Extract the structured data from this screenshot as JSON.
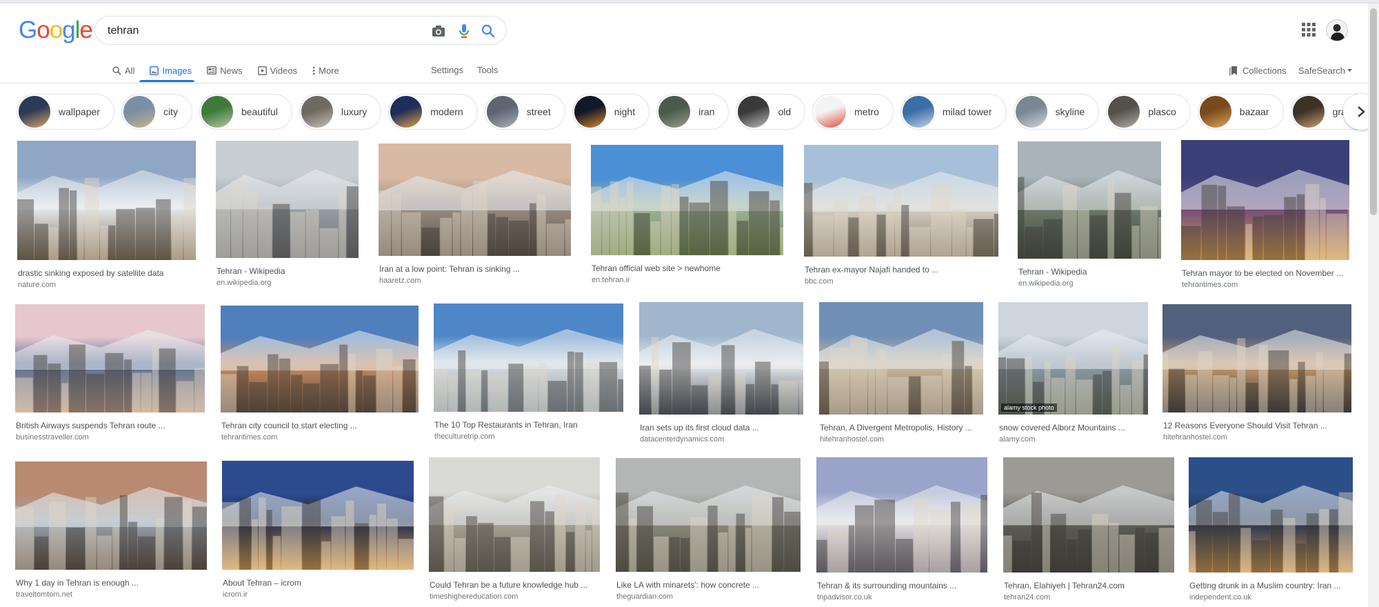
{
  "logo": {
    "text": "Google",
    "letters": [
      "G",
      "o",
      "o",
      "g",
      "l",
      "e"
    ],
    "colors": [
      "#4285f4",
      "#ea4335",
      "#fbbc05",
      "#4285f4",
      "#34a853",
      "#ea4335"
    ]
  },
  "search": {
    "query": "tehran",
    "camera_icon": "camera-icon",
    "mic_icon": "microphone-icon",
    "search_icon": "search-icon"
  },
  "header": {
    "apps_icon": "apps-grid-icon",
    "avatar_icon": "account-avatar"
  },
  "tabs": [
    {
      "label": "All",
      "icon": "search-icon"
    },
    {
      "label": "Images",
      "icon": "image-icon"
    },
    {
      "label": "News",
      "icon": "news-icon"
    },
    {
      "label": "Videos",
      "icon": "video-icon"
    },
    {
      "label": "More",
      "icon": "more-vertical-icon"
    }
  ],
  "tools": {
    "settings": "Settings",
    "tools": "Tools",
    "collections": "Collections",
    "safesearch": "SafeSearch"
  },
  "chips": [
    {
      "label": "wallpaper",
      "colors": [
        "#2b3a55",
        "#d9a36a"
      ]
    },
    {
      "label": "city",
      "colors": [
        "#7a8fa6",
        "#c9b48a"
      ]
    },
    {
      "label": "beautiful",
      "colors": [
        "#3f7a3a",
        "#b7c9a8"
      ]
    },
    {
      "label": "luxury",
      "colors": [
        "#6f6a61",
        "#c7c2b8"
      ]
    },
    {
      "label": "modern",
      "colors": [
        "#1e2d5a",
        "#e2a24b"
      ]
    },
    {
      "label": "street",
      "colors": [
        "#5e6672",
        "#a9b1ba"
      ]
    },
    {
      "label": "night",
      "colors": [
        "#121826",
        "#d98b2e"
      ]
    },
    {
      "label": "iran",
      "colors": [
        "#4b5a4c",
        "#9a9f91"
      ]
    },
    {
      "label": "old",
      "colors": [
        "#3a3a3a",
        "#bdbdbd"
      ]
    },
    {
      "label": "metro",
      "colors": [
        "#f4f4f4",
        "#e04b3c"
      ]
    },
    {
      "label": "milad tower",
      "colors": [
        "#3a6ea5",
        "#c6d7ea"
      ]
    },
    {
      "label": "skyline",
      "colors": [
        "#7b8794",
        "#d1d6db"
      ]
    },
    {
      "label": "plasco",
      "colors": [
        "#54514b",
        "#b2ada3"
      ]
    },
    {
      "label": "bazaar",
      "colors": [
        "#7a4a1f",
        "#e0a45a"
      ]
    },
    {
      "label": "grand bazaar",
      "colors": [
        "#3d3126",
        "#c9a06d"
      ]
    }
  ],
  "results": [
    {
      "title": "drastic sinking exposed by satellite data",
      "source": "nature.com",
      "colors": [
        "#8fa6c4",
        "#e9edf2",
        "#7d6a53"
      ]
    },
    {
      "title": "Tehran - Wikipedia",
      "source": "en.wikipedia.org",
      "colors": [
        "#c9ced3",
        "#9aa1a8",
        "#6b6f72"
      ]
    },
    {
      "title": "Iran at a low point: Tehran is sinking ...",
      "source": "haaretz.com",
      "colors": [
        "#d8b9a4",
        "#9c8f86",
        "#5a4d43"
      ]
    },
    {
      "title": "Tehran official web site > newhome",
      "source": "en.tehran.ir",
      "colors": [
        "#4b8fd6",
        "#9fb49a",
        "#6f8a4e"
      ]
    },
    {
      "title": "Tehran ex-mayor Najafi handed to ...",
      "source": "bbc.com",
      "colors": [
        "#a7bfd8",
        "#d6d2c8",
        "#8a7a66"
      ]
    },
    {
      "title": "Tehran - Wikipedia",
      "source": "en.wikipedia.org",
      "colors": [
        "#a9b3ba",
        "#6d7b6c",
        "#3f4a3c"
      ]
    },
    {
      "title": "Tehran mayor to be elected on November ...",
      "source": "tehrantimes.com",
      "colors": [
        "#3a3f78",
        "#6a4a7c",
        "#e0a048"
      ]
    },
    {
      "title": "British Airways suspends Tehran route ...",
      "source": "businesstraveller.com",
      "colors": [
        "#e6c7cf",
        "#5b6f94",
        "#c4a58a"
      ]
    },
    {
      "title": "Tehran city council to start electing ...",
      "source": "tehrantimes.com",
      "colors": [
        "#4f7fbd",
        "#c88c5f",
        "#5d4a3c"
      ]
    },
    {
      "title": "The 10 Top Restaurants in Tehran, Iran",
      "source": "theculturetrip.com",
      "colors": [
        "#4d87c7",
        "#d9dee3",
        "#8b9ba5"
      ]
    },
    {
      "title": "Iran sets up its first cloud data ...",
      "source": "datacenterdynamics.com",
      "colors": [
        "#9fb6cc",
        "#e9ecef",
        "#46525e"
      ]
    },
    {
      "title": "Tehran, A Divergent Metropolis, History ...",
      "source": "hitehranhostel.com",
      "colors": [
        "#6f8fb6",
        "#c9ba9f",
        "#7a6a58"
      ]
    },
    {
      "title": "snow covered Alborz Mountains ...",
      "source": "alamy.com",
      "watermark": "alamy stock photo",
      "colors": [
        "#cdd6df",
        "#8b9aa6",
        "#5f6a5c"
      ]
    },
    {
      "title": "12 Reasons Everyone Should Visit Tehran ...",
      "source": "hitehranhostel.com",
      "colors": [
        "#51607c",
        "#c79a6a",
        "#3e3a3a"
      ]
    },
    {
      "title": "Why 1 day in Tehran is enough ...",
      "source": "traveltomtom.net",
      "colors": [
        "#b98a70",
        "#9aa4af",
        "#5a4a40"
      ]
    },
    {
      "title": "About Tehran – icrom",
      "source": "icrom.ir",
      "colors": [
        "#2c4a8e",
        "#1b2a4f",
        "#e0a04a"
      ]
    },
    {
      "title": "Could Tehran be a future knowledge hub ...",
      "source": "timeshighereducation.com",
      "colors": [
        "#d9d9d6",
        "#a9a497",
        "#6e6a5e"
      ]
    },
    {
      "title": "Like LA with minarets': how concrete ...",
      "source": "theguardian.com",
      "colors": [
        "#b3b6b4",
        "#8c8a7d",
        "#5e5c50"
      ]
    },
    {
      "title": "Tehran & its surrounding mountains ...",
      "source": "tripadvisor.co.uk",
      "colors": [
        "#9aa3c9",
        "#e7e4e6",
        "#7b7284"
      ]
    },
    {
      "title": "Tehran, Elahiyeh | Tehran24.com",
      "source": "tehran24.com",
      "colors": [
        "#9b9a94",
        "#5f5e58",
        "#3d3c37"
      ]
    },
    {
      "title": "Getting drunk in a Muslim country: Iran ...",
      "source": "independent.co.uk",
      "colors": [
        "#2c4f8a",
        "#1f2f4e",
        "#d69a4b"
      ]
    }
  ]
}
